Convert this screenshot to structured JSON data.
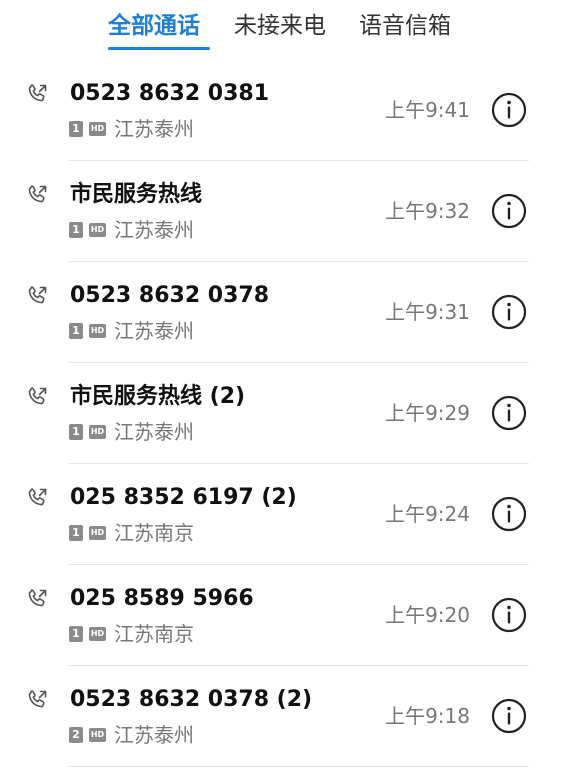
{
  "tabs": [
    {
      "label": "全部通话",
      "active": true
    },
    {
      "label": "未接来电",
      "active": false
    },
    {
      "label": "语音信箱",
      "active": false
    }
  ],
  "colors": {
    "accent": "#1e7fd4",
    "text_primary": "#111111",
    "text_secondary": "#777777"
  },
  "icons": {
    "call_type": "outgoing-call-icon",
    "info": "info-circle-icon"
  },
  "calls": [
    {
      "name": "0523 8632 0381",
      "sim": "1",
      "hd": "HD",
      "location": "江苏泰州",
      "time": "上午9:41"
    },
    {
      "name": "市民服务热线",
      "sim": "1",
      "hd": "HD",
      "location": "江苏泰州",
      "time": "上午9:32"
    },
    {
      "name": "0523 8632 0378",
      "sim": "1",
      "hd": "HD",
      "location": "江苏泰州",
      "time": "上午9:31"
    },
    {
      "name": "市民服务热线 (2)",
      "sim": "1",
      "hd": "HD",
      "location": "江苏泰州",
      "time": "上午9:29"
    },
    {
      "name": "025 8352 6197 (2)",
      "sim": "1",
      "hd": "HD",
      "location": "江苏南京",
      "time": "上午9:24"
    },
    {
      "name": "025 8589 5966",
      "sim": "1",
      "hd": "HD",
      "location": "江苏南京",
      "time": "上午9:20"
    },
    {
      "name": "0523 8632 0378 (2)",
      "sim": "2",
      "hd": "HD",
      "location": "江苏泰州",
      "time": "上午9:18"
    }
  ]
}
